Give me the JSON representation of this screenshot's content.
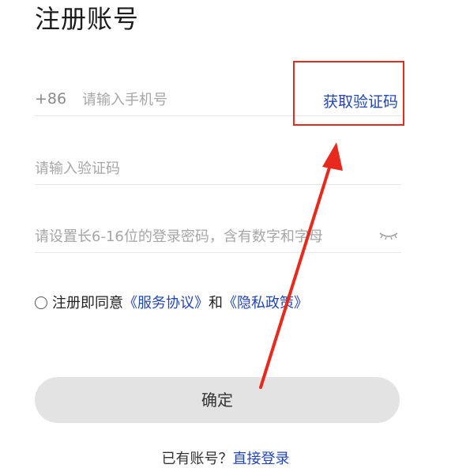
{
  "page": {
    "title": "注册账号"
  },
  "phone": {
    "prefix": "+86",
    "placeholder": "请输入手机号",
    "get_code_label": "获取验证码"
  },
  "code": {
    "placeholder": "请输入验证码"
  },
  "password": {
    "placeholder": "请设置长6-16位的登录密码，含有数字和字母",
    "toggle_icon": "eye-closed-icon"
  },
  "agreement": {
    "prefix": "注册即同意",
    "service_link": "《服务协议》",
    "connector": "和",
    "privacy_link": "《隐私政策》"
  },
  "confirm": {
    "label": "确定"
  },
  "login": {
    "prompt": "已有账号？",
    "link": "直接登录"
  },
  "annotation": {
    "highlight_color": "#e8291d"
  },
  "colors": {
    "accent": "#2346b5",
    "button_bg": "#e3e3e3"
  }
}
